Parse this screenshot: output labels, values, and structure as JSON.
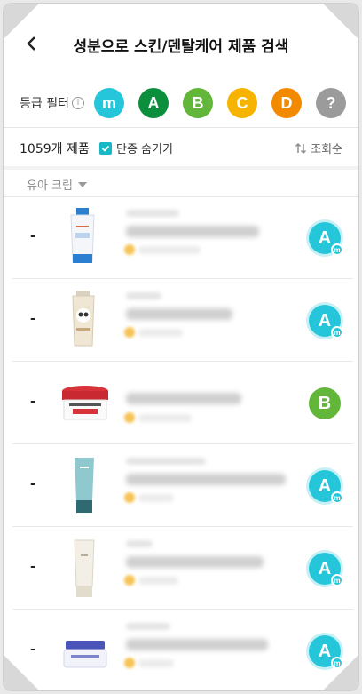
{
  "header": {
    "title": "성분으로 스킨/덴탈케어 제품 검색"
  },
  "filter": {
    "label": "등급 필터",
    "info": "i",
    "grades": [
      {
        "label": "m",
        "color": "#25c6d9"
      },
      {
        "label": "A",
        "color": "#0b8f3d"
      },
      {
        "label": "B",
        "color": "#62b63a"
      },
      {
        "label": "C",
        "color": "#f6b400"
      },
      {
        "label": "D",
        "color": "#f28a00"
      },
      {
        "label": "?",
        "color": "#9b9b9b"
      }
    ]
  },
  "list_meta": {
    "count": "1059개 제품",
    "hide_discontinued": "단종 숨기기",
    "sort": "조회순",
    "category": "유아 크림"
  },
  "products": [
    {
      "rank": "-",
      "grade": "A",
      "sub": "m"
    },
    {
      "rank": "-",
      "grade": "A",
      "sub": "m"
    },
    {
      "rank": "-",
      "grade": "B",
      "sub": ""
    },
    {
      "rank": "-",
      "grade": "A",
      "sub": "m"
    },
    {
      "rank": "-",
      "grade": "A",
      "sub": "m"
    },
    {
      "rank": "-",
      "grade": "A",
      "sub": "m"
    }
  ]
}
